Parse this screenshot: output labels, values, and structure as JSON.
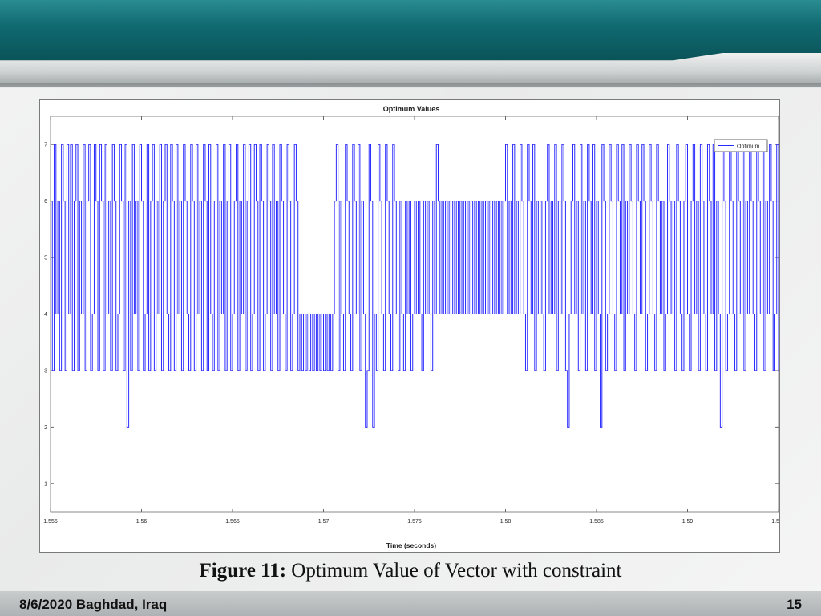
{
  "slide": {
    "caption_label": "Figure 11:",
    "caption_text": " Optimum Value of Vector with constraint",
    "footer_date": "8/6/2020 Baghdad, Iraq",
    "page_number": "15"
  },
  "chart_data": {
    "type": "line",
    "title": "Optimum Values",
    "xlabel": "Time (seconds)",
    "ylabel": "",
    "xlim": [
      1.555,
      1.595
    ],
    "ylim": [
      0.5,
      7.5
    ],
    "xticks": [
      1.555,
      1.56,
      1.565,
      1.57,
      1.575,
      1.58,
      1.585,
      1.59,
      1.595
    ],
    "xtick_labels": [
      "1.555",
      "1.56",
      "1.565",
      "1.57",
      "1.575",
      "1.58",
      "1.585",
      "1.59",
      "1.595"
    ],
    "yticks": [
      1,
      2,
      3,
      4,
      5,
      6,
      7
    ],
    "ytick_labels": [
      "1",
      "2",
      "3",
      "4",
      "5",
      "6",
      "7"
    ],
    "grid": false,
    "legend_position": "top-right",
    "line_color": "#2b2bff",
    "series": [
      {
        "name": "Optimum",
        "note": "Discrete-valued switching signal (states 2-7), approx. 0.0001 s sample step",
        "x_start": 1.555,
        "x_step": 0.0001,
        "values": [
          6,
          3,
          7,
          4,
          6,
          3,
          7,
          6,
          3,
          7,
          4,
          7,
          3,
          6,
          7,
          3,
          6,
          4,
          7,
          3,
          6,
          7,
          3,
          4,
          7,
          6,
          3,
          7,
          6,
          3,
          7,
          4,
          6,
          3,
          7,
          6,
          3,
          4,
          7,
          6,
          3,
          7,
          2,
          6,
          3,
          7,
          4,
          6,
          3,
          7,
          6,
          3,
          4,
          7,
          3,
          6,
          7,
          3,
          6,
          4,
          7,
          3,
          6,
          7,
          4,
          3,
          7,
          6,
          3,
          7,
          4,
          6,
          3,
          7,
          6,
          4,
          3,
          7,
          6,
          3,
          7,
          4,
          6,
          3,
          7,
          6,
          3,
          7,
          4,
          3,
          6,
          7,
          3,
          6,
          4,
          7,
          3,
          6,
          7,
          3,
          4,
          6,
          7,
          3,
          6,
          4,
          7,
          3,
          6,
          7,
          3,
          4,
          7,
          6,
          3,
          7,
          6,
          3,
          4,
          7,
          6,
          3,
          7,
          4,
          6,
          3,
          7,
          6,
          4,
          3,
          7,
          6,
          3,
          4,
          7,
          6,
          3,
          4,
          3,
          4,
          3,
          4,
          3,
          4,
          3,
          4,
          3,
          4,
          3,
          4,
          3,
          4,
          3,
          4,
          3,
          4,
          6,
          7,
          3,
          6,
          4,
          3,
          7,
          6,
          4,
          3,
          7,
          6,
          4,
          7,
          3,
          6,
          4,
          2,
          3,
          7,
          6,
          2,
          4,
          3,
          7,
          6,
          4,
          3,
          7,
          6,
          4,
          3,
          7,
          6,
          4,
          3,
          6,
          4,
          3,
          6,
          4,
          6,
          3,
          4,
          6,
          4,
          6,
          4,
          3,
          6,
          4,
          6,
          4,
          3,
          6,
          4,
          7,
          6,
          4,
          6,
          4,
          6,
          4,
          6,
          4,
          6,
          4,
          6,
          4,
          6,
          4,
          6,
          4,
          6,
          4,
          6,
          4,
          6,
          4,
          6,
          4,
          6,
          4,
          6,
          4,
          6,
          4,
          6,
          4,
          6,
          4,
          6,
          4,
          6,
          7,
          4,
          6,
          4,
          7,
          4,
          6,
          4,
          7,
          6,
          4,
          3,
          7,
          6,
          4,
          7,
          3,
          6,
          4,
          6,
          4,
          3,
          6,
          7,
          4,
          6,
          4,
          7,
          3,
          6,
          4,
          7,
          6,
          3,
          2,
          4,
          6,
          7,
          4,
          6,
          3,
          7,
          4,
          6,
          3,
          7,
          6,
          4,
          7,
          3,
          6,
          4,
          2,
          7,
          6,
          3,
          4,
          7,
          6,
          4,
          3,
          7,
          6,
          4,
          7,
          3,
          6,
          4,
          7,
          6,
          4,
          3,
          7,
          6,
          4,
          7,
          6,
          3,
          4,
          7,
          6,
          4,
          3,
          7,
          6,
          4,
          6,
          3,
          4,
          7,
          6,
          4,
          6,
          3,
          7,
          6,
          4,
          3,
          6,
          7,
          4,
          3,
          6,
          7,
          4,
          6,
          3,
          7,
          6,
          4,
          3,
          7,
          6,
          4,
          7,
          3,
          6,
          4,
          2,
          7,
          6,
          3,
          4,
          7,
          6,
          4,
          3,
          7,
          6,
          4,
          7,
          3,
          6,
          4,
          7,
          6,
          4,
          3,
          7,
          6,
          4,
          7,
          3,
          6,
          4,
          7,
          6,
          3,
          4,
          7,
          6,
          4,
          3,
          7,
          6,
          4,
          7,
          3,
          6,
          4,
          7,
          6,
          3,
          4,
          7,
          6,
          4,
          3,
          7,
          6,
          4,
          7,
          3,
          6,
          4,
          7,
          6,
          3,
          4,
          3,
          4,
          3,
          4,
          3,
          4,
          3,
          4,
          3,
          4,
          3,
          4,
          3,
          4,
          3,
          4,
          3,
          4,
          6,
          3,
          4,
          7,
          6,
          3,
          4,
          7,
          6,
          3,
          4,
          3,
          4,
          3,
          4,
          3,
          4,
          6,
          3,
          4,
          3,
          4,
          7,
          3,
          4,
          3,
          6,
          4,
          3,
          4,
          3,
          4
        ]
      }
    ]
  }
}
